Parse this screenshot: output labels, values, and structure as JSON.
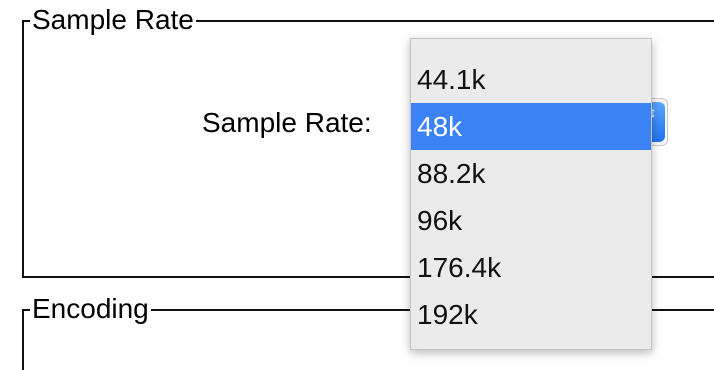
{
  "sample_rate_group": {
    "title": "Sample Rate",
    "field_label": "Sample Rate:",
    "combo_value": "48k",
    "stepper_icon": "↕"
  },
  "encoding_group": {
    "title": "Encoding"
  },
  "popup": {
    "items": [
      {
        "label": "44.1k",
        "selected": false
      },
      {
        "label": "48k",
        "selected": true
      },
      {
        "label": "88.2k",
        "selected": false
      },
      {
        "label": "96k",
        "selected": false
      },
      {
        "label": "176.4k",
        "selected": false
      },
      {
        "label": "192k",
        "selected": false
      }
    ]
  },
  "colors": {
    "selection": "#3b82f6",
    "popup_background": "#ebebeb",
    "stepper": "#2b7cf6"
  }
}
